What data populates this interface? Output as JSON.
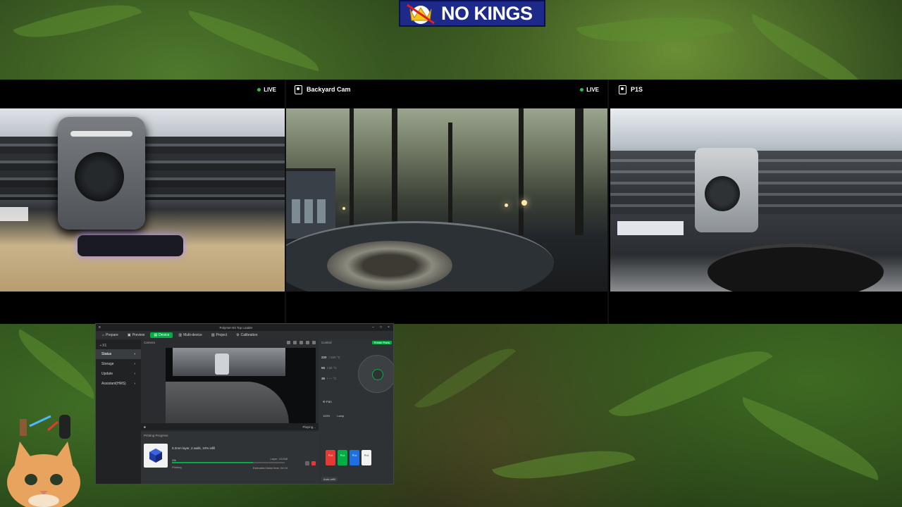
{
  "banner": {
    "text": "NO KINGS"
  },
  "cameras": [
    {
      "title": "",
      "live": "LIVE"
    },
    {
      "title": "Backyard Cam",
      "live": "LIVE"
    },
    {
      "title": "P1S",
      "live": ""
    }
  ],
  "studio": {
    "window_title": "Polymer-Kit Top Loader",
    "tabs": [
      "Prepare",
      "Preview",
      "Device",
      "Multi-device",
      "Project",
      "Calibration"
    ],
    "active_tab": "Device",
    "device_name": "X1",
    "nav": [
      "Status",
      "Storage",
      "Update",
      "Assistant(HMS)"
    ],
    "camera_label": "Camera",
    "playing": "Playing...",
    "progress_header": "Printing Progress",
    "print_label": "0.2mm layer, 2 walls, 10% infill",
    "percent": "1%",
    "progress_fraction": 0.72,
    "layer": "Layer: 12/348",
    "state": "Printing",
    "eta": "Estimated finish time: 04:19",
    "control_label": "Control",
    "printer_parts": "Printer Parts",
    "temps": [
      {
        "value": "220",
        "target": "/ 220 °C"
      },
      {
        "value": "55",
        "target": "/ 55 °C"
      },
      {
        "value": "36",
        "target": "/ — °C"
      }
    ],
    "fan": "Fan",
    "speed_pct": "100%",
    "lamp": "Lamp",
    "ams": [
      {
        "label": "PLA",
        "color": "#e53935"
      },
      {
        "label": "PLA",
        "color": "#00ae42"
      },
      {
        "label": "PLA",
        "color": "#1e6fe0"
      },
      {
        "label": "PLA",
        "color": "#f2f2f2"
      }
    ],
    "ext": "Auto-refill"
  }
}
